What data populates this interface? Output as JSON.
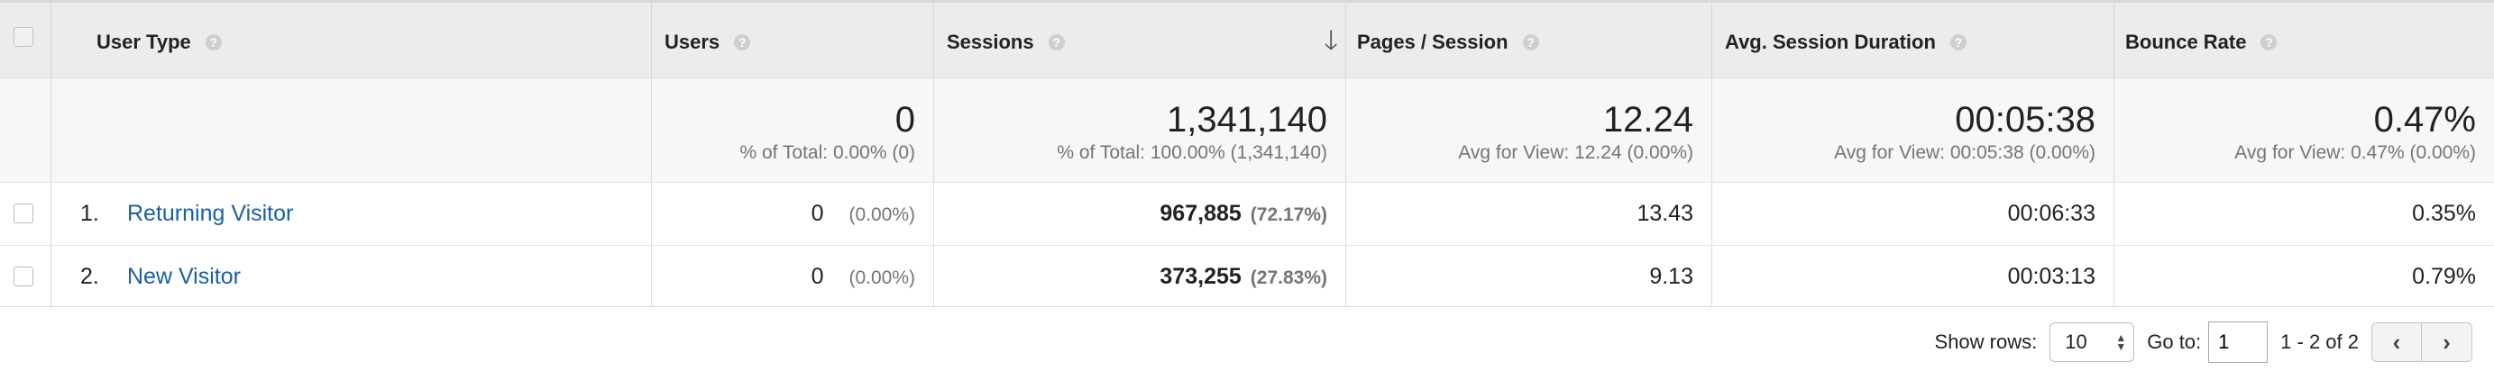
{
  "columns": {
    "dimension": "User Type",
    "users": "Users",
    "sessions": "Sessions",
    "pages_per_session": "Pages / Session",
    "avg_session_duration": "Avg. Session Duration",
    "bounce_rate": "Bounce Rate"
  },
  "help_glyph": "?",
  "sort_glyph": "🡓",
  "totals": {
    "users": {
      "value": "0",
      "sub": "% of Total: 0.00% (0)"
    },
    "sessions": {
      "value": "1,341,140",
      "sub": "% of Total: 100.00% (1,341,140)"
    },
    "pages_per_session": {
      "value": "12.24",
      "sub": "Avg for View: 12.24 (0.00%)"
    },
    "avg_session_duration": {
      "value": "00:05:38",
      "sub": "Avg for View: 00:05:38 (0.00%)"
    },
    "bounce_rate": {
      "value": "0.47%",
      "sub": "Avg for View: 0.47% (0.00%)"
    }
  },
  "rows": [
    {
      "num": "1.",
      "dimension": "Returning Visitor",
      "users": "0",
      "users_pct": "(0.00%)",
      "sessions": "967,885",
      "sessions_pct": "(72.17%)",
      "pages_per_session": "13.43",
      "avg_session_duration": "00:06:33",
      "bounce_rate": "0.35%"
    },
    {
      "num": "2.",
      "dimension": "New Visitor",
      "users": "0",
      "users_pct": "(0.00%)",
      "sessions": "373,255",
      "sessions_pct": "(27.83%)",
      "pages_per_session": "9.13",
      "avg_session_duration": "00:03:13",
      "bounce_rate": "0.79%"
    }
  ],
  "footer": {
    "show_rows_label": "Show rows:",
    "show_rows_value": "10",
    "goto_label": "Go to:",
    "goto_value": "1",
    "range": "1 - 2 of 2",
    "prev_glyph": "‹",
    "next_glyph": "›"
  }
}
